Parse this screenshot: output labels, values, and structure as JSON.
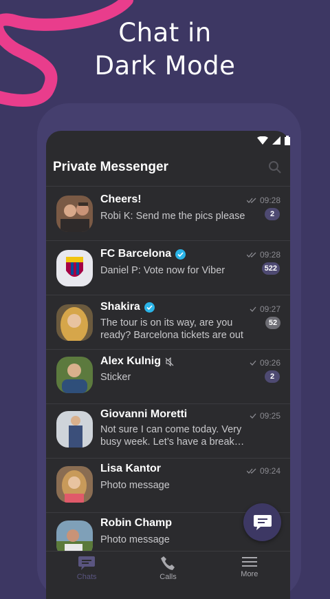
{
  "headline": {
    "line1": "Chat in",
    "line2": "Dark Mode"
  },
  "app": {
    "title": "Private Messenger"
  },
  "chats": [
    {
      "name": "Cheers!",
      "sender": "Robi K:",
      "message": "Send me the pics please",
      "time": "09:28",
      "badge": "2",
      "verified": false,
      "muted": false
    },
    {
      "name": "FC Barcelona",
      "sender": "Daniel P:",
      "message": "Vote now for Viber",
      "time": "09:28",
      "badge": "522",
      "verified": true,
      "muted": false
    },
    {
      "name": "Shakira",
      "sender": "",
      "message_line1": "The tour is on its way, are you",
      "message_line2": "ready? Barcelona tickets are out",
      "time": "09:27",
      "badge": "52",
      "verified": true,
      "muted": false
    },
    {
      "name": "Alex Kulnig",
      "sender": "",
      "message": "Sticker",
      "time": "09:26",
      "badge": "2",
      "verified": false,
      "muted": true
    },
    {
      "name": "Giovanni Moretti",
      "sender": "",
      "message_line1": "Not sure I can come today. Very",
      "message_line2": "busy week. Let’s have a break…",
      "time": "09:25",
      "badge": "",
      "verified": false,
      "muted": false
    },
    {
      "name": "Lisa Kantor",
      "sender": "",
      "message": "Photo message",
      "time": "09:24",
      "badge": "",
      "verified": false,
      "muted": false
    },
    {
      "name": "Robin Champ",
      "sender": "",
      "message": "Photo message",
      "time": "",
      "badge": "",
      "verified": false,
      "muted": false
    }
  ],
  "nav": {
    "chats": "Chats",
    "calls": "Calls",
    "more": "More"
  },
  "icons": [
    "wifi-icon",
    "signal-icon",
    "battery-icon",
    "search-icon",
    "read-check-icon",
    "verified-icon",
    "mute-icon",
    "chat-icon",
    "phone-icon",
    "menu-icon",
    "compose-icon"
  ],
  "colors": {
    "background": "#3d3763",
    "phone": "#2b2b2e",
    "accent": "#e93d8c",
    "verified": "#2ab4e8",
    "badge": "#4e4a72"
  }
}
